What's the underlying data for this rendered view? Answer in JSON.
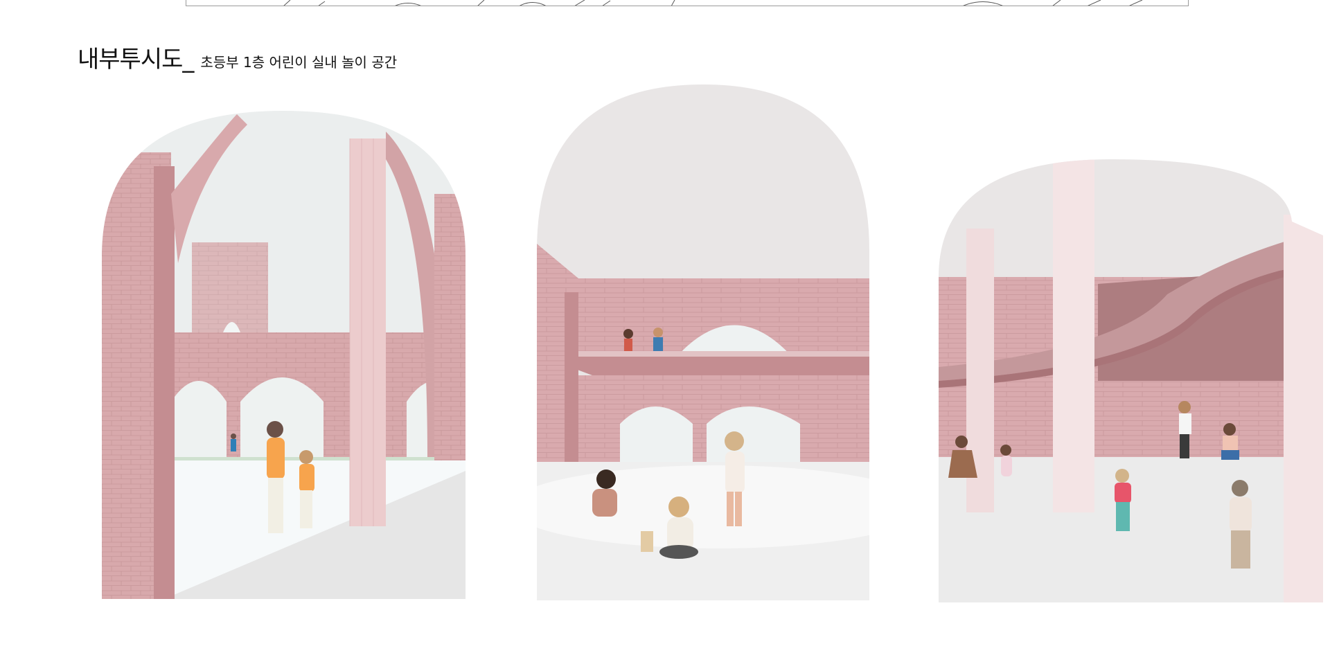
{
  "heading": {
    "title": "내부투시도_",
    "subtitle": "초등부 1층 어린이 실내 놀이 공간"
  },
  "colors": {
    "brick": "#d8a9ac",
    "brick_dark": "#c48d91",
    "brick_shadow": "#b07e82",
    "sky": "#e9e6e6",
    "floor": "#ececec",
    "floor_light": "#f7f9fb"
  },
  "panels": [
    {
      "id": "panel-left"
    },
    {
      "id": "panel-center"
    },
    {
      "id": "panel-right"
    }
  ]
}
